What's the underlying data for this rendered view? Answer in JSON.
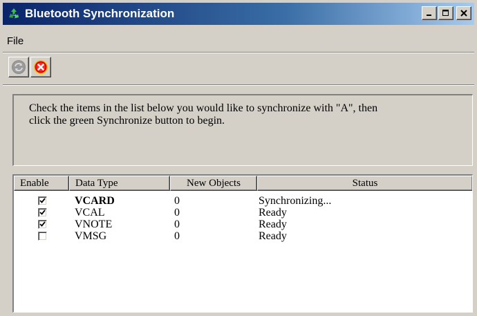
{
  "window": {
    "title": "Bluetooth Synchronization",
    "title_icon": "recycle-icon",
    "controls": [
      "minimize",
      "maximize",
      "close"
    ]
  },
  "menu": {
    "items": [
      "File"
    ]
  },
  "toolbar": {
    "buttons": [
      {
        "icon": "synchronize-icon",
        "state": "disabled"
      },
      {
        "icon": "stop-icon",
        "state": "enabled"
      }
    ]
  },
  "info": {
    "text_line1": "Check the items in the list below you would like to synchronize with \"A\", then",
    "text_line2": "click the green Synchronize button to begin."
  },
  "list": {
    "columns": [
      "Enable",
      "Data Type",
      "New Objects",
      "Status"
    ],
    "rows": [
      {
        "enabled": true,
        "data_type": "VCARD",
        "new_objects": "0",
        "status": "Synchronizing...",
        "active": true
      },
      {
        "enabled": true,
        "data_type": "VCAL",
        "new_objects": "0",
        "status": "Ready",
        "active": false
      },
      {
        "enabled": true,
        "data_type": "VNOTE",
        "new_objects": "0",
        "status": "Ready",
        "active": false
      },
      {
        "enabled": false,
        "data_type": "VMSG",
        "new_objects": "0",
        "status": "Ready",
        "active": false
      }
    ]
  },
  "colors": {
    "title_start": "#0a246a",
    "title_end": "#a6caf0",
    "face": "#d4d0c8",
    "sync_green": "#6aa84f",
    "stop_red": "#e00000"
  }
}
